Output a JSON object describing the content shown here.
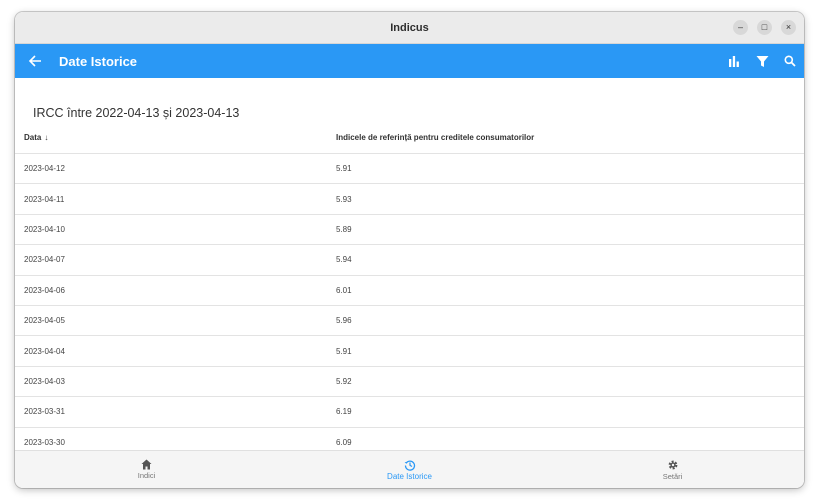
{
  "window": {
    "title": "Indicus",
    "minimize_glyph": "–",
    "maximize_glyph": "□",
    "close_glyph": "×"
  },
  "appbar": {
    "title": "Date Istorice",
    "background": "#2a98f5",
    "icons": [
      "arrow-back-icon",
      "bar-chart-icon",
      "filter-icon",
      "search-icon"
    ]
  },
  "range_title": "IRCC între 2022-04-13 și 2023-04-13",
  "table": {
    "headers": {
      "date": "Data",
      "sort_arrow": "↓",
      "value": "Indicele de referință pentru creditele consumatorilor"
    },
    "rows": [
      {
        "date": "2023-04-12",
        "value": "5.91"
      },
      {
        "date": "2023-04-11",
        "value": "5.93"
      },
      {
        "date": "2023-04-10",
        "value": "5.89"
      },
      {
        "date": "2023-04-07",
        "value": "5.94"
      },
      {
        "date": "2023-04-06",
        "value": "6.01"
      },
      {
        "date": "2023-04-05",
        "value": "5.96"
      },
      {
        "date": "2023-04-04",
        "value": "5.91"
      },
      {
        "date": "2023-04-03",
        "value": "5.92"
      },
      {
        "date": "2023-03-31",
        "value": "6.19"
      },
      {
        "date": "2023-03-30",
        "value": "6.09"
      }
    ]
  },
  "bottom_nav": {
    "items": [
      {
        "label": "Indici",
        "icon": "home-icon"
      },
      {
        "label": "Date Istorice",
        "icon": "history-icon",
        "active": true
      },
      {
        "label": "Setări",
        "icon": "gear-icon"
      }
    ]
  }
}
